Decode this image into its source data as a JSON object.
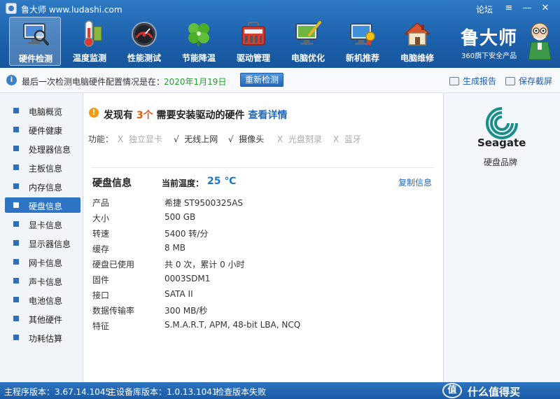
{
  "window": {
    "title": "鲁大师 www.ludashi.com",
    "forum": "论坛",
    "menu_icon": "≡",
    "min_icon": "—",
    "close_icon": "✕"
  },
  "toolbar": {
    "items": [
      {
        "label": "硬件检测",
        "icon": "monitor-magnifier-icon",
        "active": true
      },
      {
        "label": "温度监测",
        "icon": "thermometer-icon"
      },
      {
        "label": "性能测试",
        "icon": "speedometer-icon"
      },
      {
        "label": "节能降温",
        "icon": "clover-icon"
      },
      {
        "label": "驱动管理",
        "icon": "toolbox-icon"
      },
      {
        "label": "电脑优化",
        "icon": "monitor-brush-icon"
      },
      {
        "label": "新机推荐",
        "icon": "monitor-badge-icon"
      },
      {
        "label": "电脑维修",
        "icon": "house-icon"
      }
    ]
  },
  "brand": {
    "name": "鲁大师",
    "subtitle": "360旗下安全产品"
  },
  "infobar": {
    "text": "最后一次检测电脑硬件配置情况是在：",
    "date": "2020年1月19日",
    "recheck": "重新检测",
    "report": "生成报告",
    "screenshot": "保存截屏"
  },
  "sidebar": {
    "items": [
      {
        "label": "电脑概览"
      },
      {
        "label": "硬件健康"
      },
      {
        "label": "处理器信息"
      },
      {
        "label": "主板信息"
      },
      {
        "label": "内存信息"
      },
      {
        "label": "硬盘信息",
        "active": true
      },
      {
        "label": "显卡信息"
      },
      {
        "label": "显示器信息"
      },
      {
        "label": "网卡信息"
      },
      {
        "label": "声卡信息"
      },
      {
        "label": "电池信息"
      },
      {
        "label": "其他硬件"
      },
      {
        "label": "功耗估算"
      }
    ]
  },
  "alert": {
    "prefix": "发现有",
    "count": "3个",
    "suffix": "需要安装驱动的硬件",
    "link": "查看详情"
  },
  "features": {
    "label": "功能：",
    "items": [
      {
        "mark": "X",
        "text": "独立显卡",
        "enabled": false
      },
      {
        "mark": "√",
        "text": "无线上网",
        "enabled": true
      },
      {
        "mark": "√",
        "text": "摄像头",
        "enabled": true
      },
      {
        "mark": "X",
        "text": "光盘刻录",
        "enabled": false
      },
      {
        "mark": "X",
        "text": "蓝牙",
        "enabled": false
      }
    ]
  },
  "disk": {
    "title": "硬盘信息",
    "temp_label": "当前温度：",
    "temp_value": "25 ℃",
    "copy": "复制信息",
    "rows": [
      {
        "key": "产品",
        "value": "希捷 ST9500325AS"
      },
      {
        "key": "大小",
        "value": "500 GB"
      },
      {
        "key": "转速",
        "value": "5400 转/分"
      },
      {
        "key": "缓存",
        "value": "8 MB"
      },
      {
        "key": "硬盘已使用",
        "value": "共 0 次，累计 0 小时"
      },
      {
        "key": "固件",
        "value": "0003SDM1"
      },
      {
        "key": "接口",
        "value": "SATA II"
      },
      {
        "key": "数据传输率",
        "value": "300 MB/秒"
      },
      {
        "key": "特征",
        "value": "S.M.A.R.T,  APM,  48-bit LBA,  NCQ"
      }
    ]
  },
  "right_panel": {
    "brand_name": "Seagate",
    "brand_label": "硬盘品牌"
  },
  "statusbar": {
    "main_version": "主程序版本：3.67.14.1045",
    "db_version": "主设备库版本：1.0.13.1041",
    "update_status": "检查版本失败"
  },
  "watermark": {
    "mark": "值",
    "text": "什么值得买"
  }
}
